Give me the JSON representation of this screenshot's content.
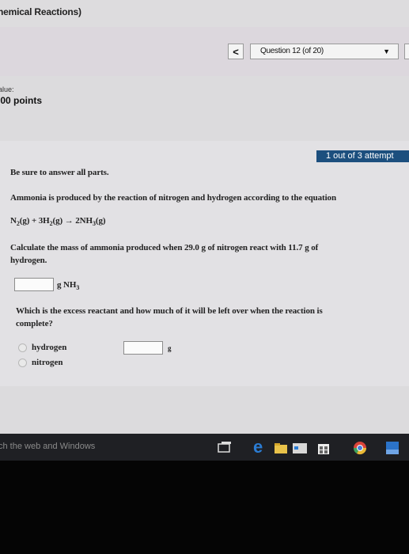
{
  "header": {
    "title": "hemical Reactions)"
  },
  "nav": {
    "prev": "<",
    "question_label": "Question 12 (of 20)",
    "arrow": "▼"
  },
  "value": {
    "label": "alue:",
    "points": ".00 points"
  },
  "attempt": {
    "text": "1 out of 3 attempt"
  },
  "question": {
    "instruction": "Be sure to answer all parts.",
    "intro": "Ammonia is produced by the reaction of nitrogen and hydrogen according to the equation",
    "eq_n": "N",
    "eq_n_sub": "2",
    "eq_g1": "(g) + 3H",
    "eq_h_sub": "2",
    "eq_g2": "(g) → 2NH",
    "eq_nh_sub": "3",
    "eq_g3": "(g)",
    "calc_line1": "Calculate the mass of ammonia produced when 29.0 g of nitrogen react with 11.7 g of",
    "calc_line2": "hydrogen.",
    "unit1": "g NH",
    "unit1_sub": "3",
    "excess_line1": "Which is the excess reactant and how much of it will be left over when the reaction is",
    "excess_line2": "complete?",
    "options": [
      "hydrogen",
      "nitrogen"
    ],
    "unit2": "g"
  },
  "taskbar": {
    "search_placeholder": "ch the web and Windows"
  },
  "colors": {
    "attempt_bg": "#1c4f7e",
    "taskbar": "#1f2024",
    "edge_blue": "#2b7cd3"
  }
}
